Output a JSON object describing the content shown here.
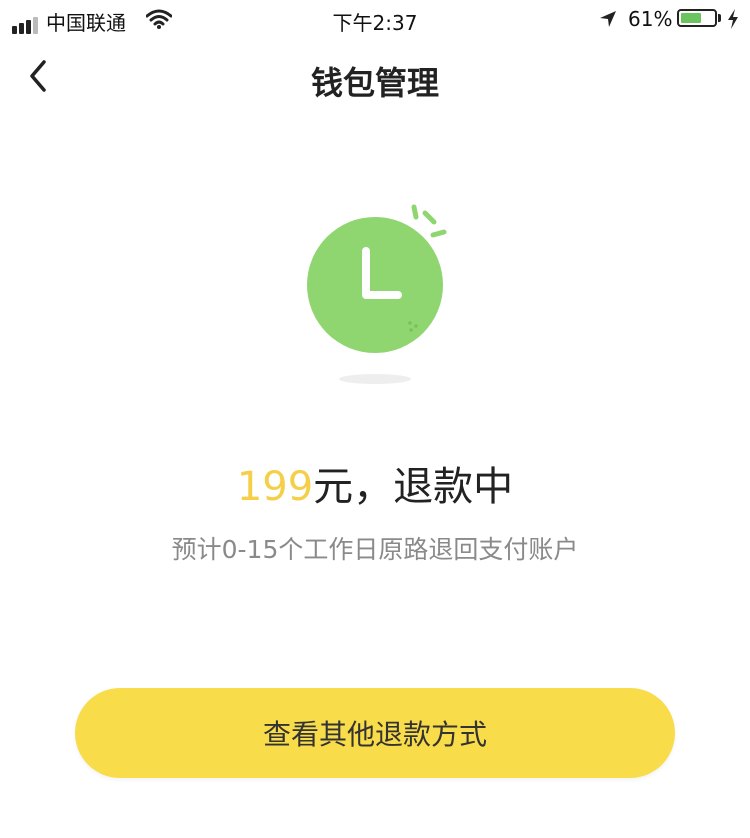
{
  "status_bar": {
    "carrier": "中国联通",
    "time": "下午2:37",
    "battery": "61%",
    "battery_level": 0.61
  },
  "nav": {
    "title": "钱包管理",
    "back_icon": "chevron-left-icon"
  },
  "illustration": {
    "icon": "clock-icon",
    "color": "#8fd671"
  },
  "refund": {
    "amount": "199",
    "status": "元，退款中",
    "note": "预计0-15个工作日原路退回支付账户"
  },
  "button": {
    "label": "查看其他退款方式",
    "color": "#f9dc4a"
  },
  "colors": {
    "accent": "#f5cf48",
    "muted_text": "#8a8a8a"
  }
}
